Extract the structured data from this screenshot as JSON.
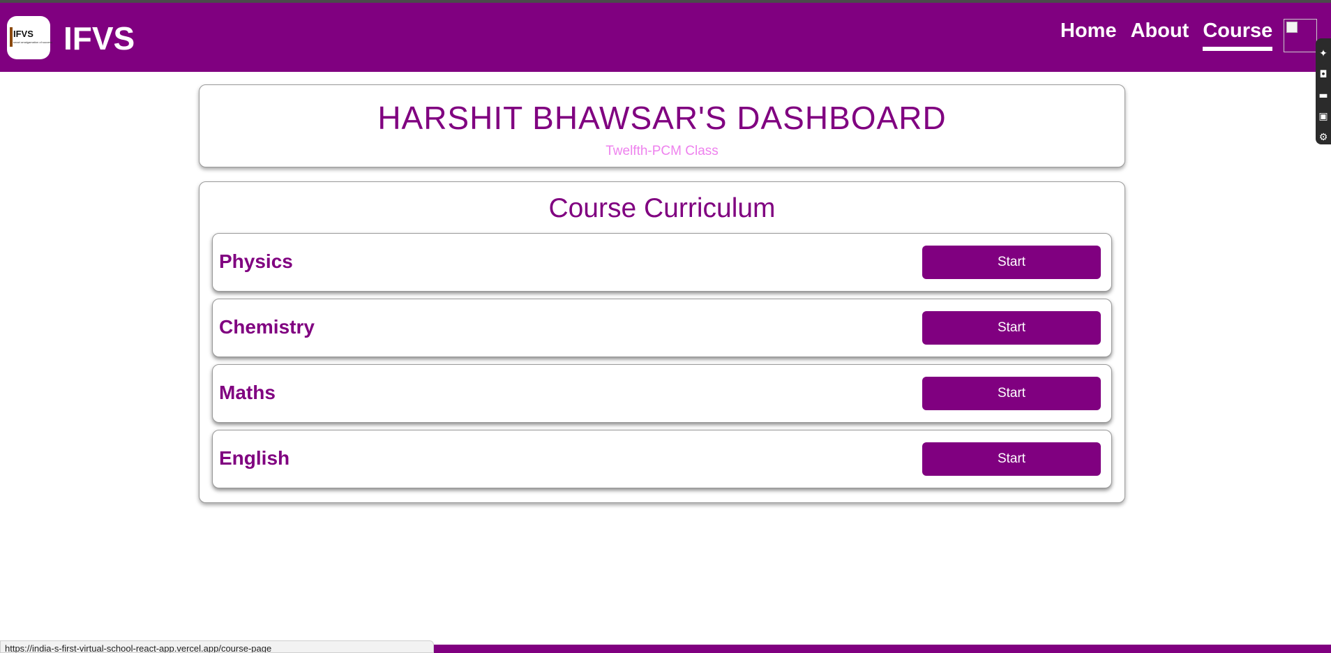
{
  "navbar": {
    "logo_text": "IFVS",
    "logo_subtext": "smart amalgamation of success",
    "brand": "IFVS",
    "links": [
      {
        "label": "Home"
      },
      {
        "label": "About"
      },
      {
        "label": "Course",
        "active": true
      }
    ],
    "accent_color": "#800080"
  },
  "side_toolbar": {
    "icons": [
      "pin-icon",
      "camera-icon",
      "square-icon",
      "gallery-icon",
      "settings-icon"
    ]
  },
  "dashboard": {
    "title": "HARSHIT BHAWSAR'S DASHBOARD",
    "subtitle": "Twelfth-PCM Class"
  },
  "curriculum": {
    "title": "Course Curriculum",
    "courses": [
      {
        "name": "Physics",
        "button": "Start"
      },
      {
        "name": "Chemistry",
        "button": "Start"
      },
      {
        "name": "Maths",
        "button": "Start"
      },
      {
        "name": "English",
        "button": "Start"
      }
    ]
  },
  "status_bar": {
    "url": "https://india-s-first-virtual-school-react-app.vercel.app/course-page"
  }
}
